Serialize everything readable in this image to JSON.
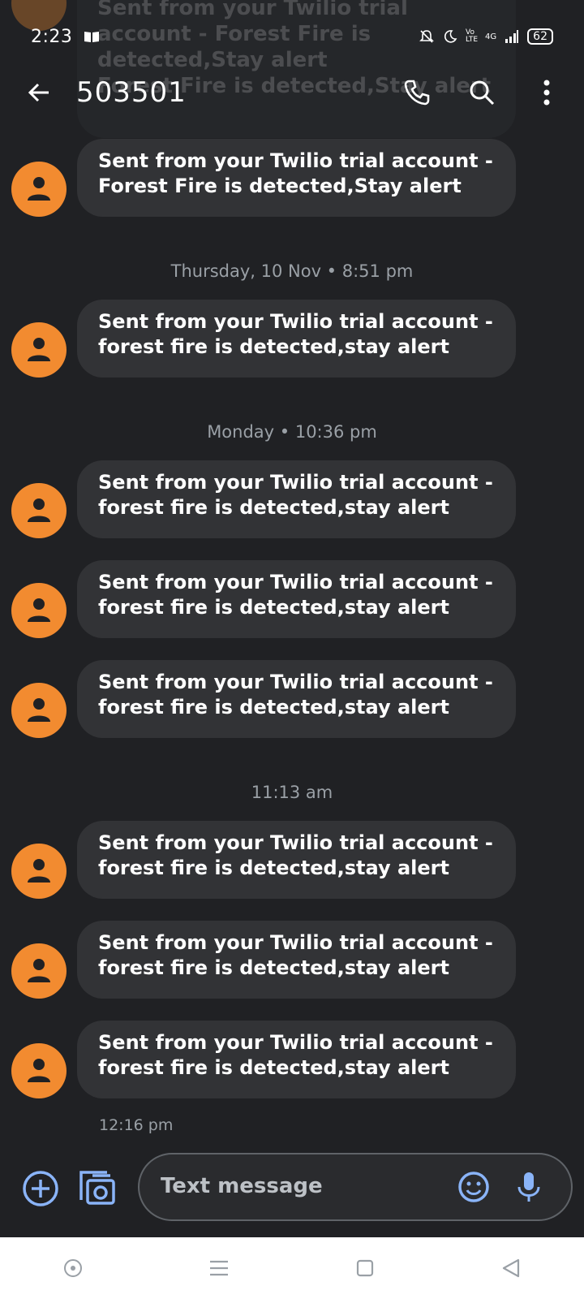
{
  "status_bar": {
    "time": "2:23",
    "battery": "62",
    "network": "4G",
    "volte": "Vo LTE"
  },
  "header": {
    "title": "503501"
  },
  "ghost_preview": {
    "text": "Sent from your Twilio trial account - Forest Fire is detected,Stay alert\nForest Fire is detected,Stay alert"
  },
  "messages": [
    {
      "text": "Sent from your Twilio trial account -\nForest Fire is detected,Stay alert"
    },
    {
      "text": "Sent from your Twilio trial account -\nforest fire is detected,stay alert"
    },
    {
      "text": "Sent from your Twilio trial account -\nforest fire is detected,stay alert"
    },
    {
      "text": "Sent from your Twilio trial account -\nforest fire is detected,stay alert"
    },
    {
      "text": "Sent from your Twilio trial account -\nforest fire is detected,stay alert"
    },
    {
      "text": "Sent from your Twilio trial account -\nforest fire is detected,stay alert"
    },
    {
      "text": "Sent from your Twilio trial account -\nforest fire is detected,stay alert"
    },
    {
      "text": "Sent from your Twilio trial account -\nforest fire is detected,stay alert"
    }
  ],
  "separators": [
    {
      "label": "Thursday, 10 Nov • 8:51 pm"
    },
    {
      "label": "Monday • 10:36 pm"
    },
    {
      "label": "11:13 am"
    }
  ],
  "last_sent_time": "12:16 pm",
  "compose": {
    "placeholder": "Text message"
  },
  "colors": {
    "background": "#202124",
    "bubble": "#323336",
    "avatar": "#f28b30",
    "accent": "#8ab4f8"
  }
}
